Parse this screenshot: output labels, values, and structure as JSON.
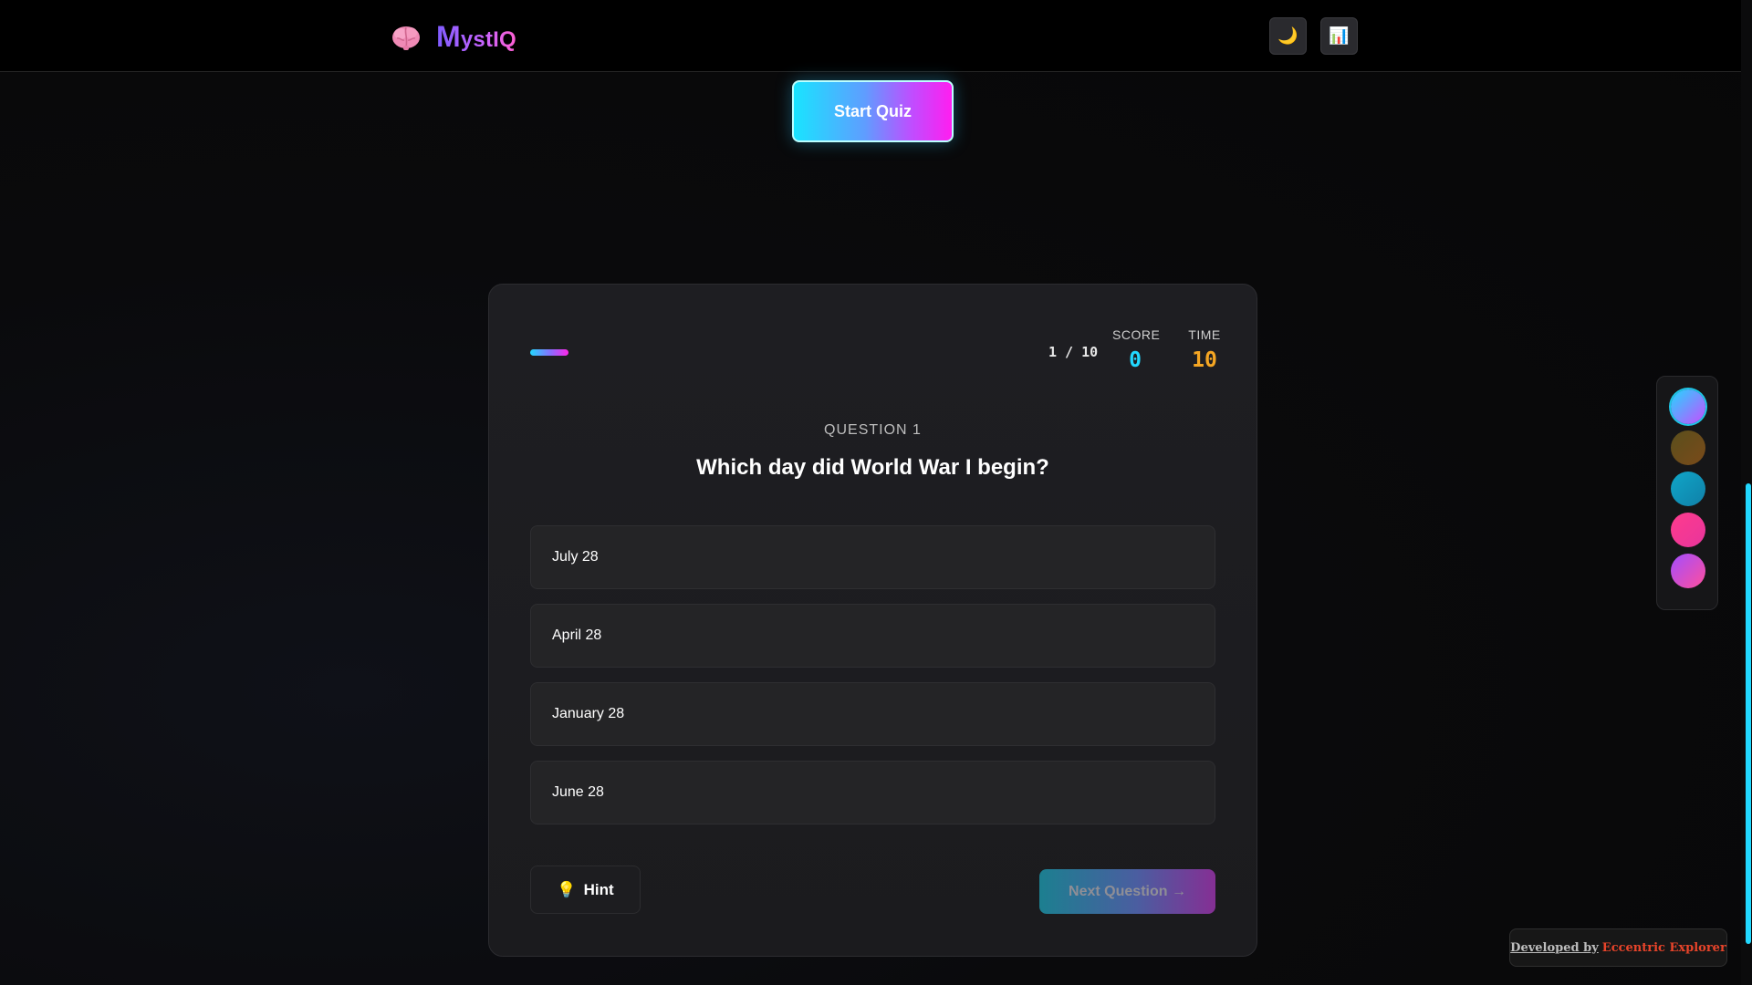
{
  "app": {
    "brand_first": "M",
    "brand_rest": "ystIQ",
    "logo_icon": "brain-icon"
  },
  "header": {
    "theme_toggle_icon": "moon-icon",
    "theme_toggle_glyph": "🌙",
    "stats_icon": "bar-chart-icon",
    "stats_glyph": "📊"
  },
  "start_button_label": "Start Quiz",
  "quiz": {
    "progress": 0.1,
    "counter": "1 / 10",
    "score_label": "SCORE",
    "score_value": "0",
    "time_label": "TIME",
    "time_value": "10",
    "question_number": "QUESTION 1",
    "question_text": "Which day did World War I begin?",
    "options": [
      "July 28",
      "April 28",
      "January 28",
      "June 28"
    ],
    "hint_icon": "lightbulb-icon",
    "hint_glyph": "💡",
    "hint_label": "Hint",
    "next_label": "Next Question →"
  },
  "theme_swatches": [
    {
      "name": "cyan-magenta",
      "selected": true
    },
    {
      "name": "olive-brown",
      "selected": false
    },
    {
      "name": "teal",
      "selected": false
    },
    {
      "name": "pink",
      "selected": false
    },
    {
      "name": "purple-pink",
      "selected": false
    }
  ],
  "colors": {
    "accent_cyan": "#22d8ff",
    "accent_magenta": "#ff25e8",
    "time_orange": "#f5a623",
    "credit_red": "#e8442a"
  },
  "credit": {
    "prefix": "Developed by",
    "name": "Eccentric Explorer"
  }
}
